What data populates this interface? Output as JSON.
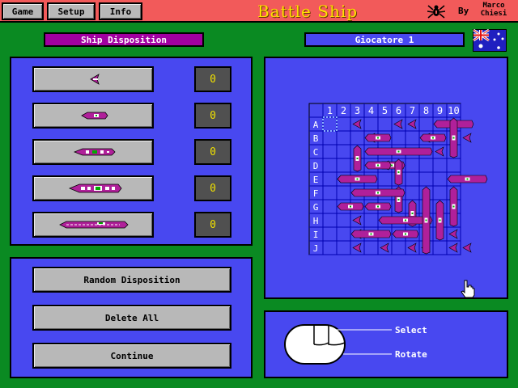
{
  "menu": {
    "game": "Game",
    "setup": "Setup",
    "info": "Info"
  },
  "app_title": "Battle Ship",
  "credit": {
    "by": "By",
    "author_line1": "Marco",
    "author_line2": "Chiesi"
  },
  "disposition_title": "Ship Disposition",
  "player_label": "Giocatore 1",
  "ships": [
    {
      "name": "ship-size-1",
      "count": "0"
    },
    {
      "name": "ship-size-2",
      "count": "0"
    },
    {
      "name": "ship-size-3",
      "count": "0"
    },
    {
      "name": "ship-size-4",
      "count": "0"
    },
    {
      "name": "ship-size-5",
      "count": "0"
    }
  ],
  "actions": {
    "random": "Random Disposition",
    "delete": "Delete All",
    "continue": "Continue"
  },
  "board": {
    "columns": [
      "1",
      "2",
      "3",
      "4",
      "5",
      "6",
      "7",
      "8",
      "9",
      "10"
    ],
    "rows": [
      "A",
      "B",
      "C",
      "D",
      "E",
      "F",
      "G",
      "H",
      "I",
      "J"
    ]
  },
  "mouse_help": {
    "left": "Select",
    "right": "Rotate"
  },
  "colors": {
    "background": "#0a8a22",
    "panel": "#4848f0",
    "titlebar": "#f25a5a",
    "title_text": "#ffe000",
    "ship": "#b0209a",
    "board_grid": "#0000b0"
  },
  "icons": [
    "spider-icon",
    "australia-flag-icon",
    "mouse-icon",
    "hand-cursor-icon"
  ]
}
